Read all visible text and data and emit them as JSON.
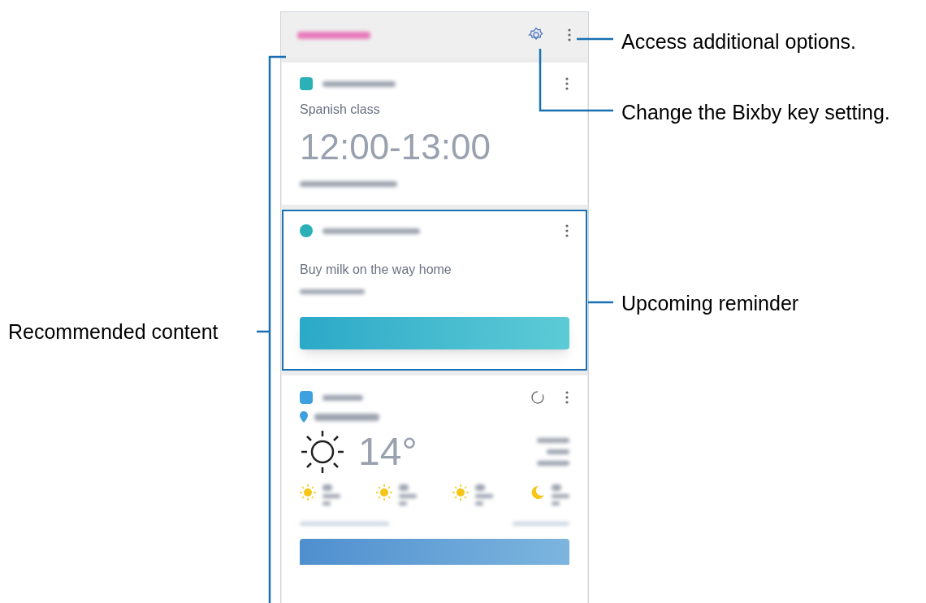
{
  "callouts": [
    {
      "kind": "options",
      "text": "Access additional options."
    },
    {
      "kind": "settings",
      "text": "Change the Bixby key setting."
    },
    {
      "kind": "reminder",
      "text": "Upcoming reminder"
    },
    {
      "kind": "recommended",
      "text": "Recommended content"
    }
  ],
  "phone": {
    "cards": [
      {
        "kind": "schedule",
        "title": "Spanish class",
        "time": "12:00-13:00",
        "highlighted": false
      },
      {
        "kind": "reminder",
        "title": "Buy milk on the way home",
        "highlighted": true
      },
      {
        "kind": "weather",
        "temperature": "14°",
        "highlighted": false
      }
    ]
  }
}
